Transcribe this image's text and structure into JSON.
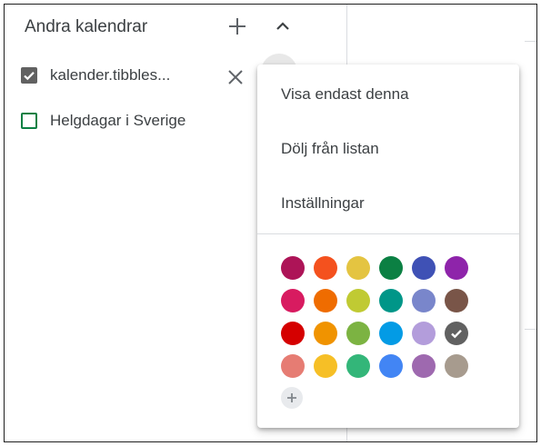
{
  "other_calendars": {
    "title": "Andra kalendrar",
    "add_icon": "plus-icon",
    "collapse_icon": "chevron-up-icon",
    "items": [
      {
        "label": "kalender.tibbles...",
        "checked": true,
        "color": "#616161",
        "remove_icon": "close-icon"
      },
      {
        "label": "Helgdagar i Sverige",
        "checked": false,
        "color": "#0b8043"
      }
    ]
  },
  "options_menu": {
    "items": [
      {
        "label": "Visa endast denna"
      },
      {
        "label": "Dölj från listan"
      },
      {
        "label": "Inställningar"
      }
    ],
    "selected_color": "#616161",
    "color_palette": [
      [
        "#ad1457",
        "#f4511e",
        "#e4c441",
        "#0b8043",
        "#3f51b5",
        "#8e24aa"
      ],
      [
        "#d81b60",
        "#ef6c00",
        "#c0ca33",
        "#009688",
        "#7986cb",
        "#795548"
      ],
      [
        "#d50000",
        "#f09300",
        "#7cb342",
        "#039be5",
        "#b39ddb",
        "#616161"
      ],
      [
        "#e67c73",
        "#f6bf26",
        "#33b679",
        "#4285f4",
        "#9e69af",
        "#a79b8e"
      ]
    ],
    "add_color_icon": "plus-icon"
  }
}
